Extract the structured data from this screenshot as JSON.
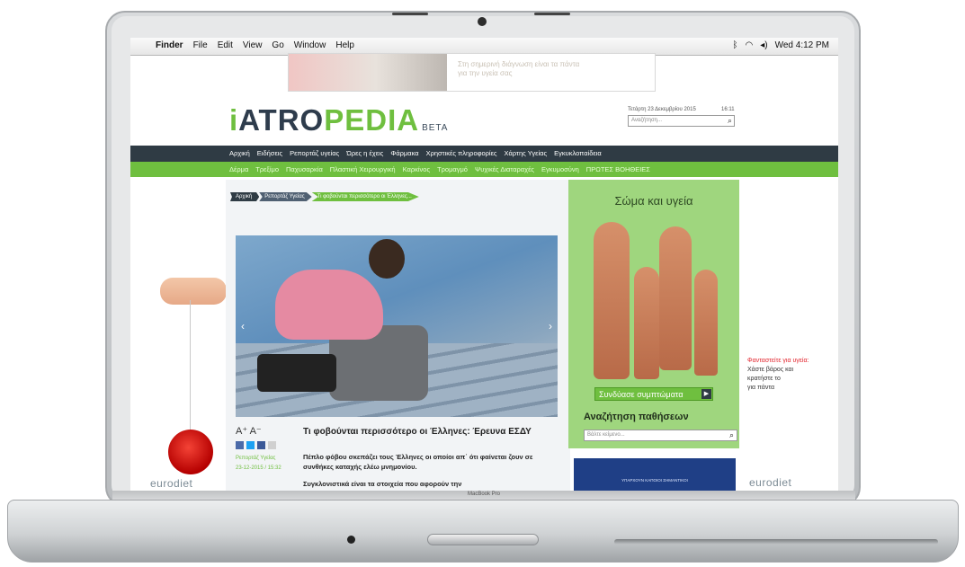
{
  "menubar": {
    "menus": [
      "Finder",
      "File",
      "Edit",
      "View",
      "Go",
      "Window",
      "Help"
    ],
    "clock": "Wed 4:12 PM"
  },
  "ad_top": {
    "text_line1": "Στη σημερινή διάγνωση είναι τα πάντα",
    "text_line2": "για την υγεία σας"
  },
  "site": {
    "logo_i": "i",
    "logo_atro": "ATRO",
    "logo_pedia": "PEDIA",
    "logo_beta": "BETA",
    "date": "Τετάρτη 23 Δεκεμβρίου 2015",
    "time": "16:11",
    "search_placeholder": "Αναζήτηση..."
  },
  "nav_main": [
    "Αρχική",
    "Ειδήσεις",
    "Ρεπορτάζ υγείας",
    "Ώρες η έχεις",
    "Φάρμακα",
    "Χρηστικές πληροφορίες",
    "Χάρτης Υγείας",
    "Εγκυκλοπαίδεια"
  ],
  "nav_sub": [
    "Δέρμα",
    "Τρεξίμο",
    "Παχυσαρκία",
    "Πλαστική Χειρουργική",
    "Καρκίνος",
    "Τρομαγμό",
    "Ψυχικές Διαταραχές",
    "Εγκυμοσύνη",
    "ΠΡΩΤΕΣ ΒΟΗΘΕΙΕΣ"
  ],
  "breadcrumb": [
    "Αρχική",
    "Ρεπορτάζ Υγείας",
    "Τι φοβούνται περισσότερο οι Έλληνες..."
  ],
  "article": {
    "font_size_label": "A⁺ A⁻",
    "category": "Ρεπορτάζ Υγείας",
    "date": "23-12-2015 / 15:32",
    "title": "Τι φοβούνται περισσότερο οι Έλληνες: Έρευνα ΕΣΔΥ",
    "lead": "Πέπλο φόβου σκεπάζει τους Έλληνες οι οποίοι απ΄ ότι φαίνεται ζουν σε συνθήκες καταχής ελέω μνημονίου.",
    "more": "Συγκλονιστικά είναι τα στοιχεία που αφορούν την"
  },
  "body_widget": {
    "title": "Σώμα και υγεία",
    "button": "Συνδύασε συμπτώματα",
    "search_title": "Αναζήτηση παθήσεων",
    "search_placeholder": "Βάλτε κείμενο..."
  },
  "side_left": {
    "brand": "eurodiet"
  },
  "side_right": {
    "brand": "eurodiet",
    "red_text": "Φανταστείτε για υγεία:",
    "text_1": "Χάστε βάρος και",
    "text_2": "κρατήστε το",
    "text_3": "για πάντα"
  },
  "blue_ad": {
    "text": "ΥΠΑΡΧΟΥΝ ΚΑΠΟΙΟΙ ΣΗΜΑΝΤΙΚΟΙ"
  },
  "laptop": {
    "model": "MacBook Pro"
  },
  "colors": {
    "brand_green": "#6fbf3f",
    "nav_dark": "#2f3b44"
  }
}
